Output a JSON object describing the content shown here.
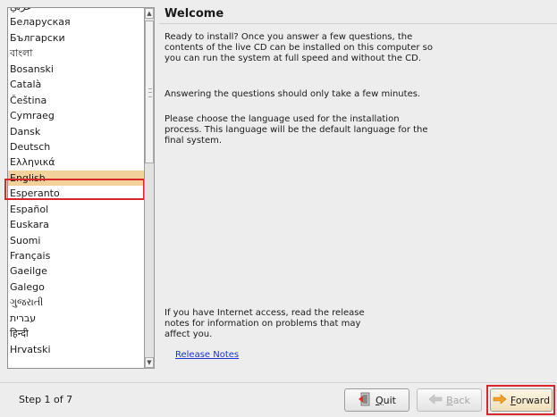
{
  "languages": [
    {
      "label": "عربي"
    },
    {
      "label": "Беларуская"
    },
    {
      "label": "Български"
    },
    {
      "label": "বাংলা"
    },
    {
      "label": "Bosanski"
    },
    {
      "label": "Català"
    },
    {
      "label": "Čeština"
    },
    {
      "label": "Cymraeg"
    },
    {
      "label": "Dansk"
    },
    {
      "label": "Deutsch"
    },
    {
      "label": "Ελληνικά"
    },
    {
      "label": "English",
      "selected": true
    },
    {
      "label": "Esperanto"
    },
    {
      "label": "Español"
    },
    {
      "label": "Euskara"
    },
    {
      "label": "Suomi"
    },
    {
      "label": "Français"
    },
    {
      "label": "Gaeilge"
    },
    {
      "label": "Galego"
    },
    {
      "label": "ગુજરાતી"
    },
    {
      "label": "עברית"
    },
    {
      "label": "हिन्दी"
    },
    {
      "label": "Hrvatski"
    }
  ],
  "welcome": {
    "title": "Welcome",
    "para1": "Ready to install? Once you answer a few questions, the contents of the live CD can be installed on this computer so you can run the system at full speed and without the CD.",
    "para2": "Answering the questions should only take a few minutes.",
    "para3": "Please choose the language used for the installation process. This language will be the default language for the final system.",
    "internet_note": "If you have Internet access, read the release notes for information on problems that may affect you.",
    "release_notes_link": "Release Notes"
  },
  "footer": {
    "step": "Step 1 of 7",
    "quit_label": "Quit",
    "back_label": "Back",
    "forward_label": "Forward"
  },
  "colors": {
    "selection": "#f2d29a",
    "highlight_border": "#d7272b",
    "link": "#1b35c9"
  },
  "icons": {
    "quit": "quit-icon",
    "back": "back-arrow-icon",
    "forward": "forward-arrow-icon"
  }
}
